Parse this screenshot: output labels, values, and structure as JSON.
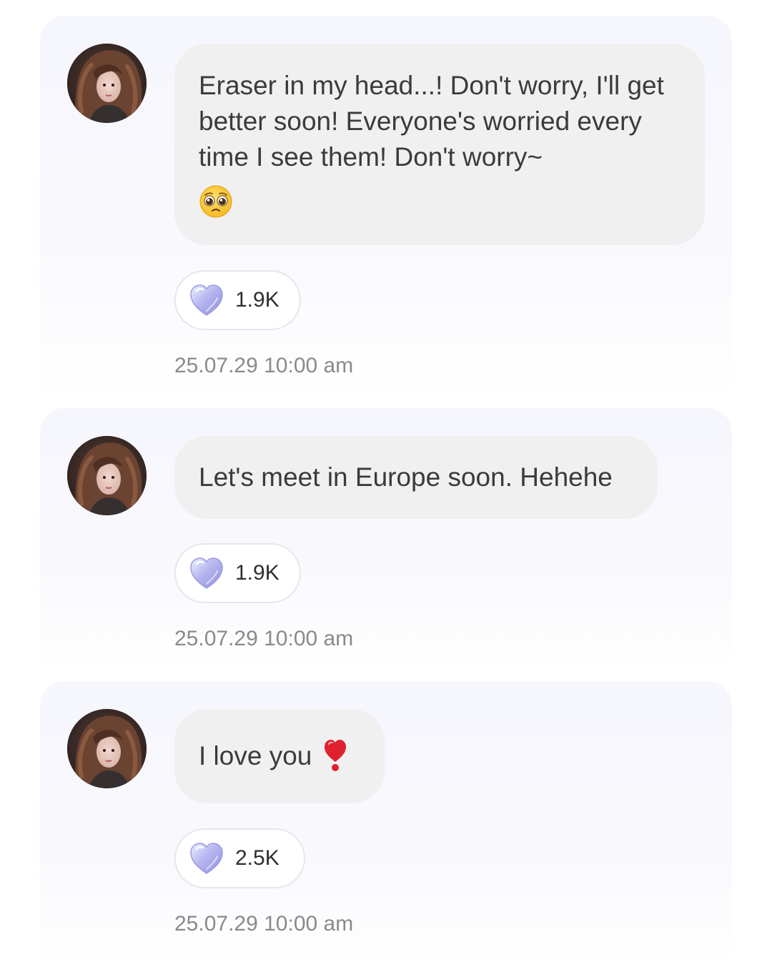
{
  "posts": [
    {
      "message": "Eraser in my head...! Don't worry, I'll get better soon! Everyone's worried every time I see them! Don't worry~",
      "emoji": "pleading-face",
      "likes": "1.9K",
      "timestamp": "25.07.29 10:00 am"
    },
    {
      "message": "Let's meet in Europe soon. Hehehe",
      "likes": "1.9K",
      "timestamp": "25.07.29 10:00 am"
    },
    {
      "message": "I love you",
      "emoji": "heavy-heart-exclamation",
      "likes": "2.5K",
      "timestamp": "25.07.29 10:00 am"
    }
  ],
  "colors": {
    "card_background": "#f6f6fd",
    "bubble_background": "#f0f0f1",
    "message_text": "#3b3b3d",
    "timestamp_text": "#8a8a8e",
    "like_heart": "#b9b7ee",
    "exclamation_heart": "#e0202e"
  },
  "icons": {
    "like": "crystal-heart-icon",
    "avatar": "profile-photo"
  }
}
